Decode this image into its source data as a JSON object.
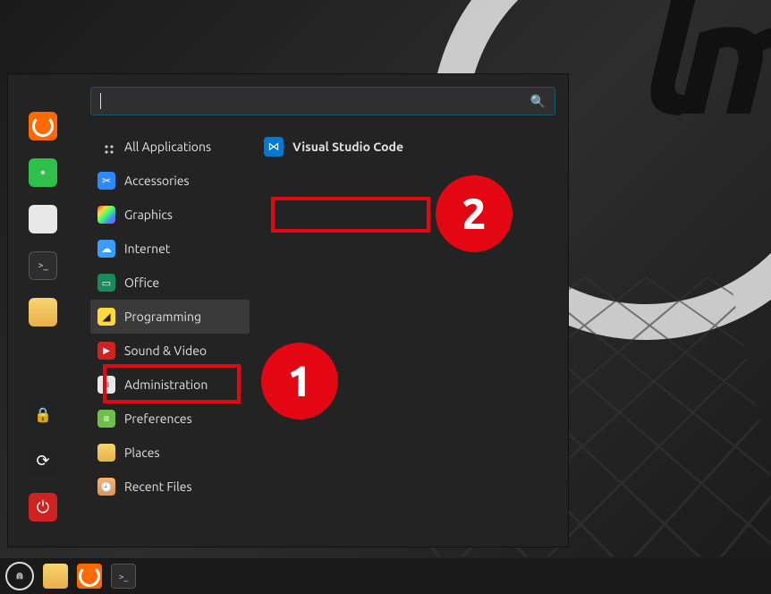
{
  "search": {
    "value": ""
  },
  "favorites": {
    "top": [
      {
        "name": "firefox",
        "icon_class": "icon-firefox"
      },
      {
        "name": "chat",
        "icon_class": "icon-whatsapp",
        "glyph": "●"
      },
      {
        "name": "display-settings",
        "icon_class": "icon-display"
      },
      {
        "name": "terminal",
        "icon_class": "icon-terminal",
        "glyph": ">_"
      },
      {
        "name": "files",
        "icon_class": "icon-files"
      }
    ],
    "bottom": [
      {
        "name": "lock",
        "icon_class": "icon-lock",
        "glyph": "🔒"
      },
      {
        "name": "logout",
        "icon_class": "icon-logout",
        "glyph": "⟳"
      },
      {
        "name": "power",
        "icon_class": "icon-power",
        "glyph": "⏻"
      }
    ]
  },
  "categories": [
    {
      "label": "All Applications",
      "icon_class": "all-apps-icon",
      "glyph": "",
      "selected": false
    },
    {
      "label": "Accessories",
      "icon_class": "cat-accessories",
      "glyph": "✂",
      "selected": false
    },
    {
      "label": "Graphics",
      "icon_class": "cat-graphics",
      "glyph": "",
      "selected": false
    },
    {
      "label": "Internet",
      "icon_class": "cat-internet",
      "glyph": "☁",
      "selected": false
    },
    {
      "label": "Office",
      "icon_class": "cat-office",
      "glyph": "▭",
      "selected": false
    },
    {
      "label": "Programming",
      "icon_class": "cat-programming",
      "glyph": "◢",
      "selected": true
    },
    {
      "label": "Sound & Video",
      "icon_class": "cat-sound",
      "glyph": "▶",
      "selected": false
    },
    {
      "label": "Administration",
      "icon_class": "cat-admin",
      "glyph": "≡",
      "selected": false
    },
    {
      "label": "Preferences",
      "icon_class": "cat-prefs",
      "glyph": "≡",
      "selected": false
    },
    {
      "label": "Places",
      "icon_class": "cat-places",
      "glyph": "",
      "selected": false
    },
    {
      "label": "Recent Files",
      "icon_class": "cat-recent",
      "glyph": "🕘",
      "selected": false
    }
  ],
  "apps": [
    {
      "label": "Visual Studio Code",
      "icon_class": "app-vscode",
      "glyph": "⋈",
      "bold": true
    }
  ],
  "taskbar": [
    {
      "name": "mint-menu",
      "icon_class": "icon-mint",
      "glyph": "⋒"
    },
    {
      "name": "files",
      "icon_class": "icon-files",
      "glyph": ""
    },
    {
      "name": "firefox",
      "icon_class": "icon-firefox",
      "glyph": ""
    },
    {
      "name": "terminal",
      "icon_class": "icon-terminal",
      "glyph": ">_"
    }
  ],
  "annotations": {
    "badge1": "1",
    "badge2": "2"
  }
}
